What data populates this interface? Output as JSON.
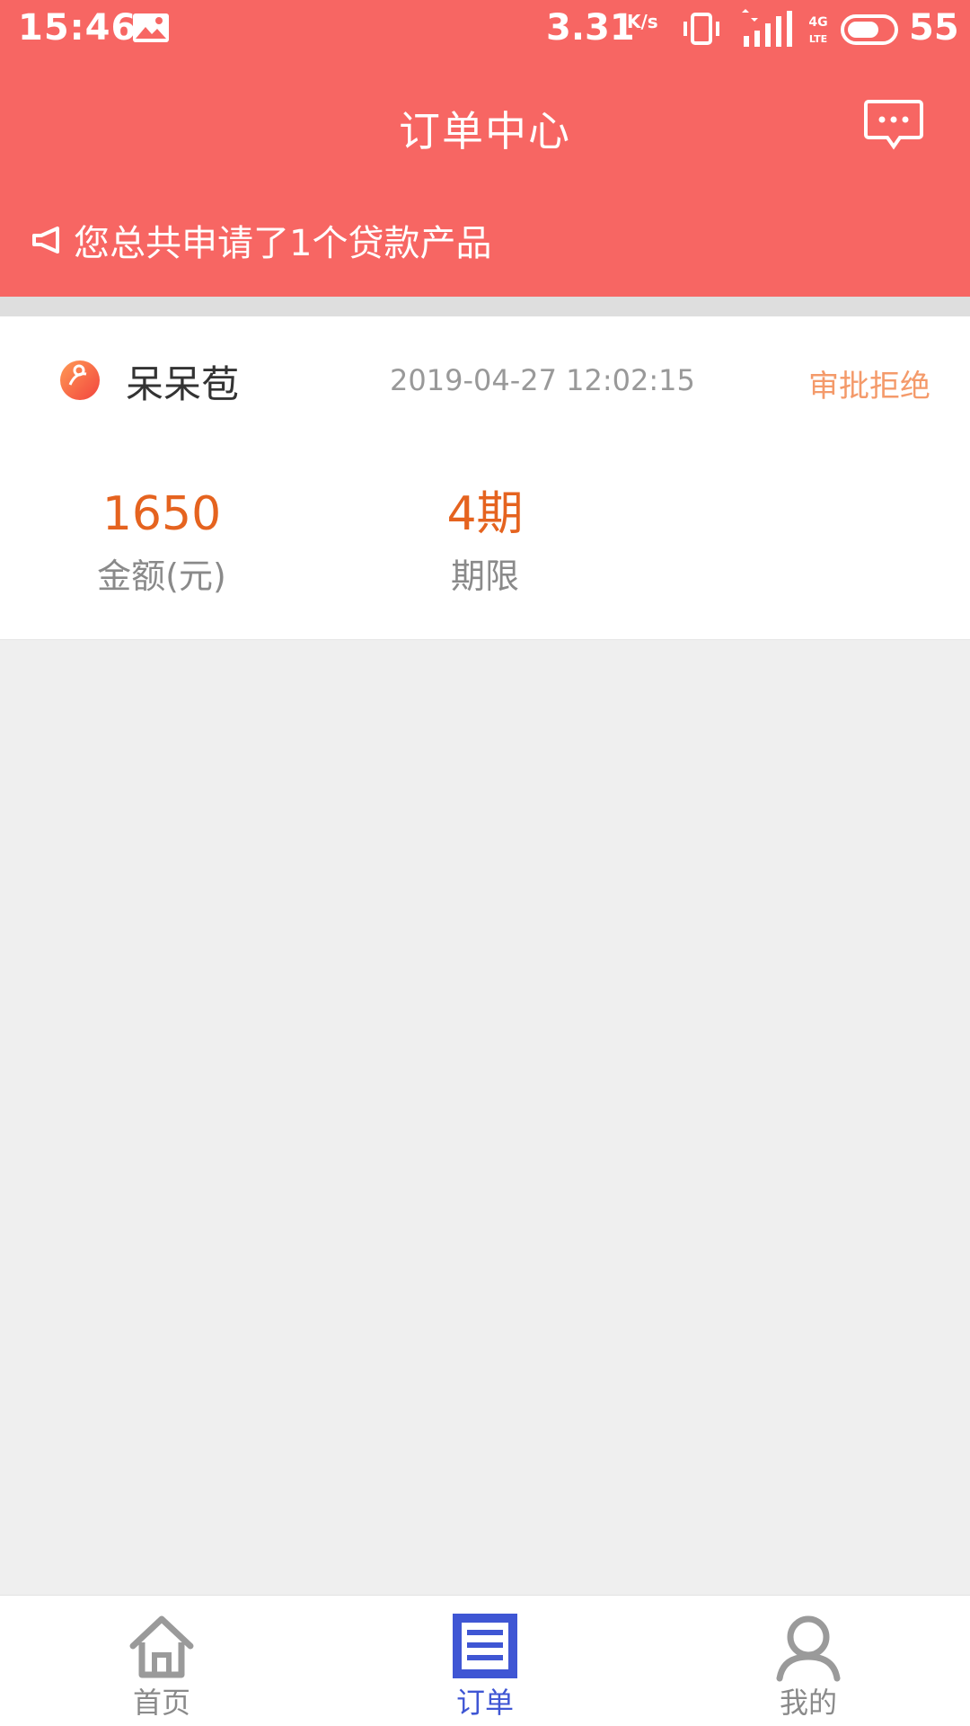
{
  "status_bar": {
    "time": "15:46",
    "speed": "3.31",
    "speed_unit": "K/s",
    "battery": "55"
  },
  "header": {
    "title": "订单中心"
  },
  "notice": {
    "text": "您总共申请了1个贷款产品"
  },
  "order": {
    "product_name": "呆呆苞",
    "time": "2019-04-27 12:02:15",
    "status": "审批拒绝",
    "amount_value": "1650",
    "amount_label": "金额(元)",
    "term_value": "4期",
    "term_label": "期限"
  },
  "tabs": [
    {
      "label": "首页",
      "icon": "home-icon",
      "active": false
    },
    {
      "label": "订单",
      "icon": "order-icon",
      "active": true
    },
    {
      "label": "我的",
      "icon": "user-icon",
      "active": false
    }
  ],
  "colors": {
    "header_bg": "#f76663",
    "accent_orange": "#e5631f",
    "status_orange": "#f49a6a",
    "tab_active": "#3f56d4",
    "tab_inactive": "#8a8a8a"
  }
}
